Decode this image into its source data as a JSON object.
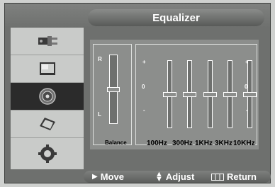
{
  "title": "Equalizer",
  "sidebar": {
    "items": [
      {
        "icon": "plug-icon"
      },
      {
        "icon": "picture-icon"
      },
      {
        "icon": "speaker-icon"
      },
      {
        "icon": "window-icon"
      },
      {
        "icon": "gear-icon"
      }
    ],
    "active_index": 2
  },
  "balance": {
    "top_label": "R",
    "bottom_label": "L",
    "label": "Balance",
    "level": 0.5
  },
  "scale": {
    "plus": "+",
    "zero": "0",
    "minus": "-"
  },
  "bands": [
    {
      "label": "100Hz",
      "level": 0.5
    },
    {
      "label": "300Hz",
      "level": 0.5
    },
    {
      "label": "1KHz",
      "level": 0.5
    },
    {
      "label": "3KHz",
      "level": 0.5
    },
    {
      "label": "10KHz",
      "level": 0.5
    }
  ],
  "bottom": {
    "move": "Move",
    "adjust": "Adjust",
    "return": "Return"
  }
}
